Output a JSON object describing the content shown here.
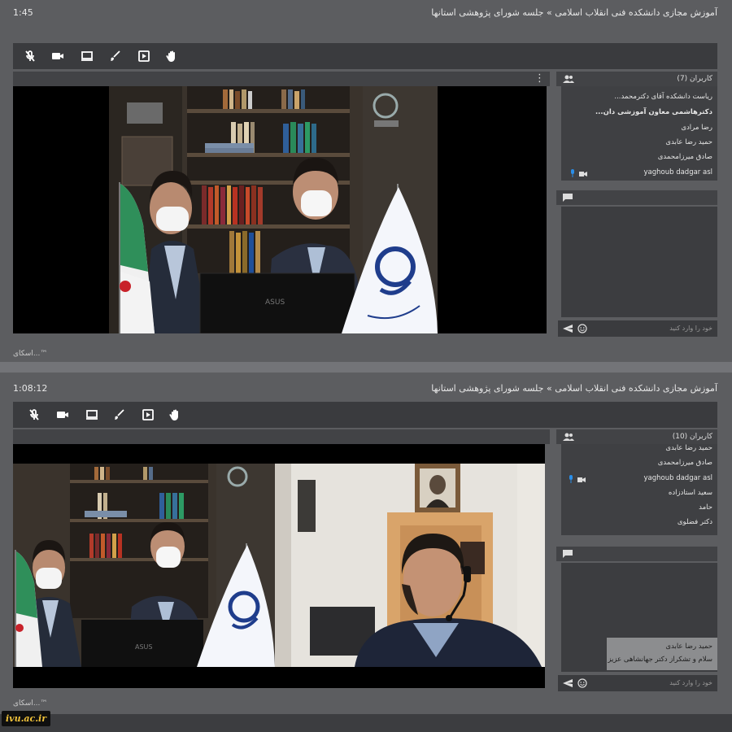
{
  "session_1": {
    "time": "1:45",
    "title": "آموزش مجازی دانشکده فنی انقلاب اسلامی » جلسه شورای پژوهشی استانها",
    "participants_header": "کاربران (7)",
    "participants": [
      "ریاست دانشکده آقای دکترمحمد...",
      "دکترهاشمی معاون آموزشی دان...",
      "رضا مرادی",
      "حمید رضا عابدی",
      "صادق میرزامحمدی",
      "yaghoub dadgar asl"
    ],
    "chat_placeholder": "خود را وارد کنید",
    "video_footer": "اسکای...™"
  },
  "session_2": {
    "time": "1:08:12",
    "title": "آموزش مجازی دانشکده فنی انقلاب اسلامی » جلسه شورای پژوهشی استانها",
    "participants_header": "کاربران (10)",
    "participants": [
      "حمید رضا عابدی",
      "صادق میرزامحمدی",
      "yaghoub dadgar asl",
      "سعید استادزاده",
      "حامد",
      "دکتر فضلوی"
    ],
    "chat_message_name": "حمید رضا عابدی",
    "chat_message_text": "سلام و تشکراز دکتر جهانشاهی عزیز",
    "chat_placeholder": "خود را وارد کنید",
    "video_footer": "اسکای...™"
  },
  "toolbar_icons": [
    "mic-muted-icon",
    "camera-icon",
    "screen-share-icon",
    "whiteboard-brush-icon",
    "play-icon",
    "raise-hand-icon"
  ],
  "watermark": "ivu.ac.ir",
  "colors": {
    "panel": "#5c5d60",
    "toolbar": "#3a3b3e",
    "flag_green": "#2f8f5a",
    "flag_red": "#c8222a",
    "logo_blue": "#1f3d8c",
    "mic_active": "#2a8ee8"
  }
}
